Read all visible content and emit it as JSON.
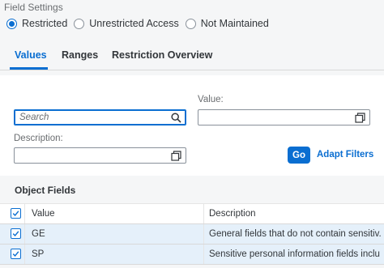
{
  "field_settings": {
    "title": "Field Settings",
    "options": [
      {
        "label": "Restricted",
        "selected": true
      },
      {
        "label": "Unrestricted Access",
        "selected": false
      },
      {
        "label": "Not Maintained",
        "selected": false
      }
    ]
  },
  "tabs": [
    {
      "label": "Values",
      "active": true
    },
    {
      "label": "Ranges",
      "active": false
    },
    {
      "label": "Restriction Overview",
      "active": false
    }
  ],
  "filters": {
    "search": {
      "placeholder": "Search",
      "value": "",
      "icon": "search-icon"
    },
    "value": {
      "label": "Value:",
      "value": "",
      "icon": "value-help-icon"
    },
    "description": {
      "label": "Description:",
      "value": "",
      "icon": "value-help-icon"
    },
    "go_label": "Go",
    "adapt_label": "Adapt Filters"
  },
  "table": {
    "title": "Object Fields",
    "columns": [
      "Value",
      "Description"
    ],
    "rows": [
      {
        "value": "GE",
        "description": "General fields that do not contain sensitiv...",
        "selected": true
      },
      {
        "value": "SP",
        "description": "Sensitive personal information fields inclu...",
        "selected": true
      }
    ]
  },
  "colors": {
    "accent": "#0a6ed1",
    "selected_row": "#e5f0fa",
    "background": "#f5f6f7"
  }
}
